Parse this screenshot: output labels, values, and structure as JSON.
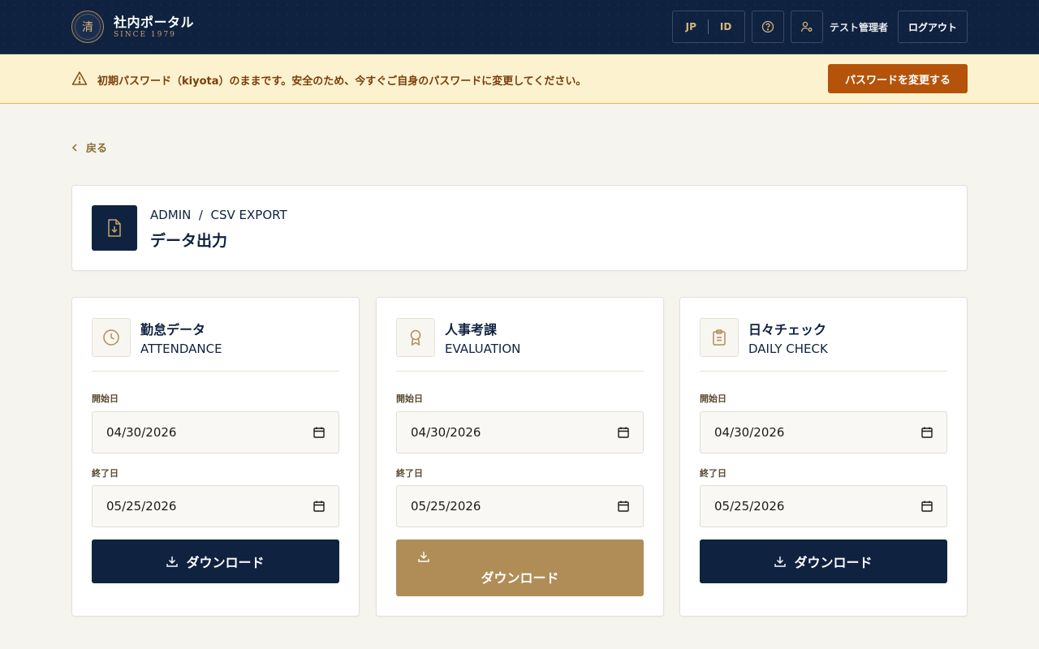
{
  "header": {
    "brand_title": "社内ポータル",
    "brand_sub": "SINCE 1979",
    "seal_char": "清",
    "lang_jp": "JP",
    "lang_id": "ID",
    "username": "テスト管理者",
    "logout": "ログアウト"
  },
  "banner": {
    "message": "初期パスワード（kiyota）のままです。安全のため、今すぐご自身のパスワードに変更してください。",
    "button": "パスワードを変更する"
  },
  "nav": {
    "back": "戻る"
  },
  "page": {
    "breadcrumb": "ADMIN  /  CSV EXPORT",
    "title": "データ出力"
  },
  "labels": {
    "start_date": "開始日",
    "end_date": "終了日",
    "download": "ダウンロード"
  },
  "cards": [
    {
      "title": "勤怠データ",
      "subtitle": "ATTENDANCE",
      "icon": "clock-icon",
      "start": "04/30/2026",
      "end": "05/25/2026"
    },
    {
      "title": "人事考課",
      "subtitle": "EVALUATION",
      "icon": "award-icon",
      "start": "04/30/2026",
      "end": "05/25/2026"
    },
    {
      "title": "日々チェック",
      "subtitle": "DAILY CHECK",
      "icon": "clipboard-icon",
      "start": "04/30/2026",
      "end": "05/25/2026"
    }
  ],
  "colors": {
    "navy": "#0f2240",
    "gold": "#b08d57",
    "warning_bg": "#fdf2cf",
    "warning_button": "#b45309"
  }
}
